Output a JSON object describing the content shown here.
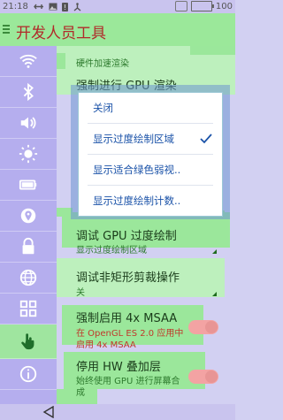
{
  "status_bar": {
    "time": "21:18",
    "battery": "100"
  },
  "titlebar": {
    "title": "开发人员工具"
  },
  "sidebar": {
    "items": [
      {
        "icon": "wifi-icon"
      },
      {
        "icon": "bluetooth-icon"
      },
      {
        "icon": "volume-icon"
      },
      {
        "icon": "brightness-icon"
      },
      {
        "icon": "battery-icon"
      },
      {
        "icon": "location-icon"
      },
      {
        "icon": "lock-icon"
      },
      {
        "icon": "globe-icon"
      },
      {
        "icon": "apps-grid-icon"
      },
      {
        "icon": "hand-touch-icon",
        "active": true
      },
      {
        "icon": "info-icon"
      }
    ]
  },
  "settings": {
    "hw_accel_header": "硬件加速渲染",
    "force_gpu": "强制进行 GPU 渲染",
    "debug_overdraw_title": "调试 GPU 过度绘制",
    "debug_overdraw_value": "显示过度绘制区域",
    "clip_title": "调试非矩形剪裁操作",
    "clip_value": "关",
    "msaa_title": "强制启用 4x MSAA",
    "msaa_sub_1": "在 OpenGL ES 2.0 应用中",
    "msaa_sub_2": "启用 4x MSAA",
    "hw_overlay_title": "停用 HW 叠加层",
    "hw_overlay_sub_1": "始终使用 GPU 进行屏幕合",
    "hw_overlay_sub_2": "成"
  },
  "popup": {
    "options": [
      {
        "label": "关闭",
        "selected": false
      },
      {
        "label": "显示过度绘制区域",
        "selected": true
      },
      {
        "label": "显示适合绿色弱视..",
        "selected": false
      },
      {
        "label": "显示过度绘制计数..",
        "selected": false
      }
    ]
  },
  "colors": {
    "overdraw_green": "#9be79b",
    "overdraw_purple": "#bcb4f0",
    "overdraw_red": "#f0a0a0",
    "accent_blue": "#1a52a8",
    "title_red": "#b12a2a"
  }
}
